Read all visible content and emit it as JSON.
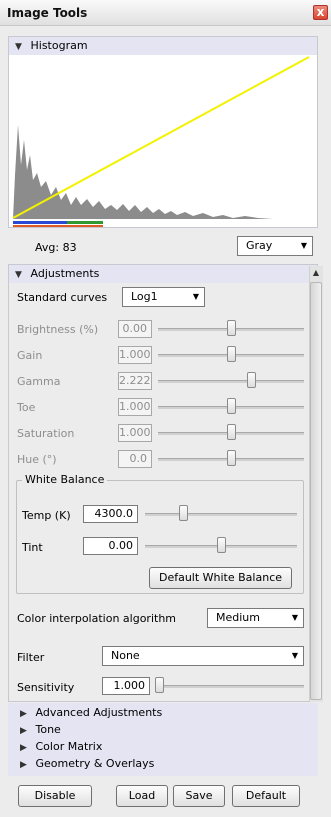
{
  "window": {
    "title": "Image Tools",
    "close_glyph": "x"
  },
  "histogram": {
    "section_label": "Histogram",
    "avg_text": "Avg: 83",
    "channel_select": "Gray",
    "curve_color": "#f2f200",
    "fill_color": "#8c8c8c",
    "bar_colors": [
      "#2a4ad6",
      "#2f9a2f",
      "#e05a24"
    ]
  },
  "adjustments": {
    "section_label": "Adjustments",
    "standard_curves_label": "Standard curves",
    "standard_curves_value": "Log1",
    "rows": [
      {
        "label": "Brightness (%)",
        "value": "0.00",
        "level": 0.5
      },
      {
        "label": "Gain",
        "value": "1.000",
        "level": 0.5
      },
      {
        "label": "Gamma",
        "value": "2.222",
        "level": 0.65
      },
      {
        "label": "Toe",
        "value": "1.000",
        "level": 0.5
      },
      {
        "label": "Saturation",
        "value": "1.000",
        "level": 0.5
      },
      {
        "label": "Hue (°)",
        "value": "0.0",
        "level": 0.5
      }
    ],
    "white_balance": {
      "title": "White Balance",
      "temp_label": "Temp (K)",
      "temp_value": "4300.0",
      "temp_level": 0.24,
      "tint_label": "Tint",
      "tint_value": "0.00",
      "tint_level": 0.5,
      "default_button": "Default White Balance"
    },
    "interp_label": "Color interpolation algorithm",
    "interp_value": "Medium",
    "filter_label": "Filter",
    "filter_value": "None",
    "sensitivity_label": "Sensitivity",
    "sensitivity_value": "1.000",
    "sensitivity_level": 0.0
  },
  "collapsed_sections": [
    "Advanced Adjustments",
    "Tone",
    "Color Matrix",
    "Geometry & Overlays"
  ],
  "footer": {
    "disable": "Disable",
    "load": "Load",
    "save": "Save",
    "default": "Default"
  }
}
